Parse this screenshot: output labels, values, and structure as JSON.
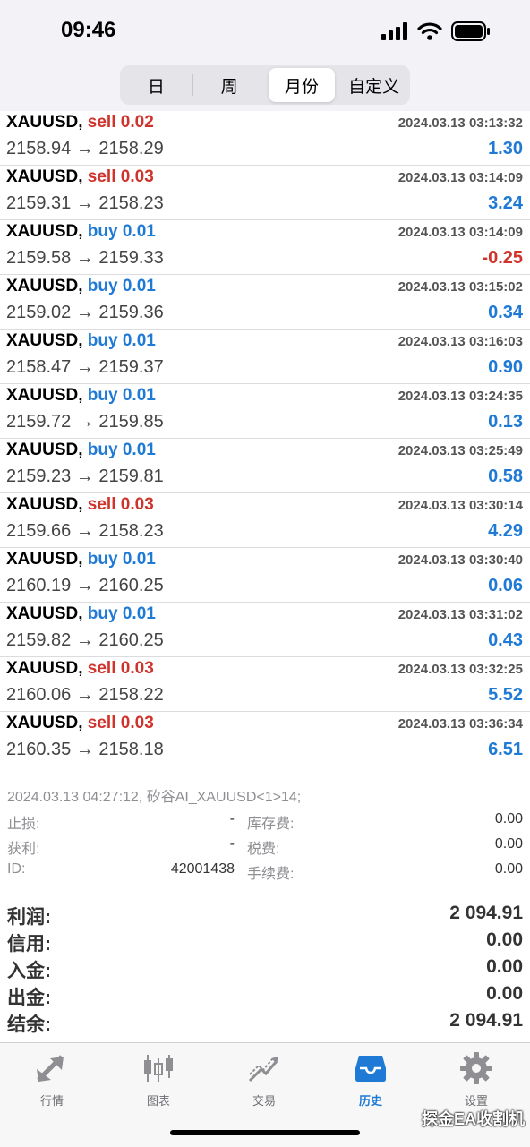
{
  "status": {
    "time": "09:46"
  },
  "segments": [
    {
      "label": "日",
      "active": false
    },
    {
      "label": "周",
      "active": false
    },
    {
      "label": "月份",
      "active": true
    },
    {
      "label": "自定义",
      "active": false
    }
  ],
  "trades": [
    {
      "symbol": "XAUUSD,",
      "dir": "sell",
      "lots": "0.02",
      "time": "2024.03.13 03:13:32",
      "prices": "2158.94 → 2158.29",
      "profit": "1.30"
    },
    {
      "symbol": "XAUUSD,",
      "dir": "sell",
      "lots": "0.03",
      "time": "2024.03.13 03:14:09",
      "prices": "2159.31 → 2158.23",
      "profit": "3.24"
    },
    {
      "symbol": "XAUUSD,",
      "dir": "buy",
      "lots": "0.01",
      "time": "2024.03.13 03:14:09",
      "prices": "2159.58 → 2159.33",
      "profit": "-0.25"
    },
    {
      "symbol": "XAUUSD,",
      "dir": "buy",
      "lots": "0.01",
      "time": "2024.03.13 03:15:02",
      "prices": "2159.02 → 2159.36",
      "profit": "0.34"
    },
    {
      "symbol": "XAUUSD,",
      "dir": "buy",
      "lots": "0.01",
      "time": "2024.03.13 03:16:03",
      "prices": "2158.47 → 2159.37",
      "profit": "0.90"
    },
    {
      "symbol": "XAUUSD,",
      "dir": "buy",
      "lots": "0.01",
      "time": "2024.03.13 03:24:35",
      "prices": "2159.72 → 2159.85",
      "profit": "0.13"
    },
    {
      "symbol": "XAUUSD,",
      "dir": "buy",
      "lots": "0.01",
      "time": "2024.03.13 03:25:49",
      "prices": "2159.23 → 2159.81",
      "profit": "0.58"
    },
    {
      "symbol": "XAUUSD,",
      "dir": "sell",
      "lots": "0.03",
      "time": "2024.03.13 03:30:14",
      "prices": "2159.66 → 2158.23",
      "profit": "4.29"
    },
    {
      "symbol": "XAUUSD,",
      "dir": "buy",
      "lots": "0.01",
      "time": "2024.03.13 03:30:40",
      "prices": "2160.19 → 2160.25",
      "profit": "0.06"
    },
    {
      "symbol": "XAUUSD,",
      "dir": "buy",
      "lots": "0.01",
      "time": "2024.03.13 03:31:02",
      "prices": "2159.82 → 2160.25",
      "profit": "0.43"
    },
    {
      "symbol": "XAUUSD,",
      "dir": "sell",
      "lots": "0.03",
      "time": "2024.03.13 03:32:25",
      "prices": "2160.06 → 2158.22",
      "profit": "5.52"
    },
    {
      "symbol": "XAUUSD,",
      "dir": "sell",
      "lots": "0.03",
      "time": "2024.03.13 03:36:34",
      "prices": "2160.35 → 2158.18",
      "profit": "6.51"
    }
  ],
  "note": "2024.03.13 04:27:12, 矽谷AI_XAUUSD<1>14;",
  "details": {
    "stop_loss_label": "止损:",
    "stop_loss_value": "-",
    "swap_label": "库存费:",
    "swap_value": "0.00",
    "take_profit_label": "获利:",
    "take_profit_value": "-",
    "tax_label": "税费:",
    "tax_value": "0.00",
    "id_label": "ID:",
    "id_value": "42001438",
    "commission_label": "手续费:",
    "commission_value": "0.00"
  },
  "summary": {
    "profit_label": "利润:",
    "profit_value": "2 094.91",
    "credit_label": "信用:",
    "credit_value": "0.00",
    "deposit_label": "入金:",
    "deposit_value": "0.00",
    "withdraw_label": "出金:",
    "withdraw_value": "0.00",
    "balance_label": "结余:",
    "balance_value": "2 094.91"
  },
  "tabs": [
    {
      "label": "行情",
      "icon": "quotes-arrows-icon",
      "active": false
    },
    {
      "label": "图表",
      "icon": "candlestick-chart-icon",
      "active": false
    },
    {
      "label": "交易",
      "icon": "trade-chart-icon",
      "active": false
    },
    {
      "label": "历史",
      "icon": "history-inbox-icon",
      "active": true
    },
    {
      "label": "设置",
      "icon": "gear-icon",
      "active": false
    }
  ],
  "watermark": "探金EA收割机",
  "colors": {
    "sell": "#d0332b",
    "buy": "#1f7ad6",
    "accent": "#1f7ad6"
  }
}
